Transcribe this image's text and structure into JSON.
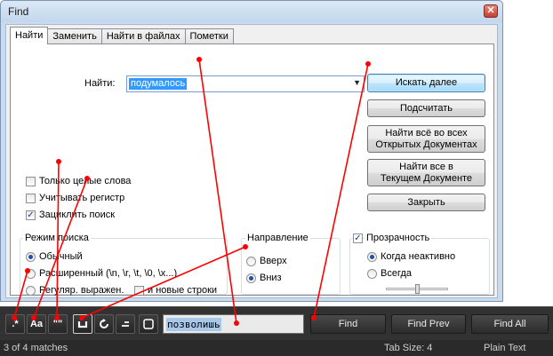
{
  "window": {
    "title": "Find",
    "close_glyph": "✕"
  },
  "tabs": [
    {
      "label": "Найти",
      "active": true
    },
    {
      "label": "Заменить",
      "active": false
    },
    {
      "label": "Найти в файлах",
      "active": false
    },
    {
      "label": "Пометки",
      "active": false
    }
  ],
  "find": {
    "label": "Найти:",
    "value": "подумалось",
    "dropdown_icon": "chevron-down-icon"
  },
  "buttons": {
    "find_next": "Искать далее",
    "count": "Подсчитать",
    "find_all_open_1": "Найти всё во всех",
    "find_all_open_2": "Открытых Документах",
    "find_all_current_1": "Найти все в",
    "find_all_current_2": "Текущем Документе",
    "close": "Закрыть"
  },
  "options": {
    "whole_words": {
      "label": "Только целые слова",
      "checked": false
    },
    "match_case": {
      "label": "Учитывать регистр",
      "checked": false
    },
    "wrap": {
      "label": "Зациклить поиск",
      "checked": true
    }
  },
  "search_mode": {
    "title": "Режим поиска",
    "normal": {
      "label": "Обычный",
      "selected": true
    },
    "extended": {
      "label": "Расширенный (\\n, \\r, \\t, \\0, \\x...)",
      "selected": false
    },
    "regex": {
      "label": "Регуляр. выражен.",
      "selected": false
    },
    "newlines": {
      "label": "и новые строки",
      "checked": false
    }
  },
  "direction": {
    "title": "Направление",
    "up": {
      "label": "Вверх",
      "selected": false
    },
    "down": {
      "label": "Вниз",
      "selected": true
    }
  },
  "transparency": {
    "label": "Прозрачность",
    "checked": true,
    "inactive": {
      "label": "Когда неактивно",
      "selected": true
    },
    "always": {
      "label": "Всегда",
      "selected": false
    }
  },
  "findbar": {
    "btn_regex": ".*",
    "btn_case": "Aa",
    "btn_words": "\"\"",
    "btn_wrap_icon": "wrap-icon",
    "btn_in_selection_icon": "in-selection-icon",
    "btn_highlight_icon": "highlight-icon",
    "btn_box_icon": "box-icon",
    "query": "позволишь",
    "find": "Find",
    "find_prev": "Find Prev",
    "find_all": "Find All"
  },
  "status": {
    "matches": "3 of 4 matches",
    "tab_size": "Tab Size: 4",
    "syntax": "Plain Text"
  },
  "colors": {
    "annotation": "#ff0000",
    "accent": "#3399ff",
    "bar_bg": "#323232"
  }
}
